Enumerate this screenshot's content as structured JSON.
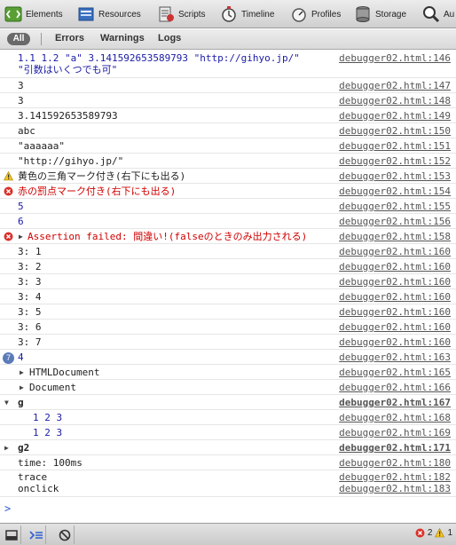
{
  "toolbar": {
    "tabs": [
      {
        "label": "Elements",
        "icon": "elements-icon"
      },
      {
        "label": "Resources",
        "icon": "resources-icon"
      },
      {
        "label": "Scripts",
        "icon": "scripts-icon"
      },
      {
        "label": "Timeline",
        "icon": "timeline-icon"
      },
      {
        "label": "Profiles",
        "icon": "profiles-icon"
      },
      {
        "label": "Storage",
        "icon": "storage-icon"
      },
      {
        "label": "Au",
        "icon": "audits-icon"
      }
    ]
  },
  "filters": {
    "all": "All",
    "errors": "Errors",
    "warnings": "Warnings",
    "logs": "Logs"
  },
  "messages": [
    {
      "text": "1.1 1.2 \"a\" 3.141592653589793 \"http://gihyo.jp/\"\n\"引数はいくつでも可\"",
      "source": "debugger02.html:146",
      "kind": "log",
      "color": "#1a1aa6"
    },
    {
      "text": "3",
      "source": "debugger02.html:147",
      "kind": "log"
    },
    {
      "text": "3",
      "source": "debugger02.html:148",
      "kind": "log"
    },
    {
      "text": "3.141592653589793",
      "source": "debugger02.html:149",
      "kind": "log"
    },
    {
      "text": "abc",
      "source": "debugger02.html:150",
      "kind": "log"
    },
    {
      "text": "\"aaaaaa\"",
      "source": "debugger02.html:151",
      "kind": "log"
    },
    {
      "text": "\"http://gihyo.jp/\"",
      "source": "debugger02.html:152",
      "kind": "log"
    },
    {
      "text": "黄色の三角マーク付き(右下にも出る)",
      "source": "debugger02.html:153",
      "kind": "warning"
    },
    {
      "text": "赤の罰点マーク付き(右下にも出る)",
      "source": "debugger02.html:154",
      "kind": "error",
      "color": "#d00000"
    },
    {
      "text": "5",
      "source": "debugger02.html:155",
      "kind": "log",
      "color": "#1a1aa6"
    },
    {
      "text": "6",
      "source": "debugger02.html:156",
      "kind": "log",
      "color": "#1a1aa6"
    },
    {
      "text": "Assertion failed: 間違い!(falseのときのみ出力される)",
      "source": "debugger02.html:158",
      "kind": "error-expand",
      "color": "#d00000"
    },
    {
      "text": "3: 1",
      "source": "debugger02.html:160",
      "kind": "log"
    },
    {
      "text": "3: 2",
      "source": "debugger02.html:160",
      "kind": "log"
    },
    {
      "text": "3: 3",
      "source": "debugger02.html:160",
      "kind": "log"
    },
    {
      "text": "3: 4",
      "source": "debugger02.html:160",
      "kind": "log"
    },
    {
      "text": "3: 5",
      "source": "debugger02.html:160",
      "kind": "log"
    },
    {
      "text": "3: 6",
      "source": "debugger02.html:160",
      "kind": "log"
    },
    {
      "text": "3: 7",
      "source": "debugger02.html:160",
      "kind": "log"
    },
    {
      "text": "4",
      "source": "debugger02.html:163",
      "kind": "repeat",
      "count": "7",
      "color": "#1a1aa6"
    },
    {
      "text": "HTMLDocument",
      "source": "debugger02.html:165",
      "kind": "expand"
    },
    {
      "text": "Document",
      "source": "debugger02.html:166",
      "kind": "expand"
    },
    {
      "text": "g",
      "source": "debugger02.html:167",
      "kind": "group-open",
      "bold": true
    },
    {
      "text": "1 2 3",
      "source": "debugger02.html:168",
      "kind": "nested",
      "color": "#1a1aa6"
    },
    {
      "text": "1 2 3",
      "source": "debugger02.html:169",
      "kind": "nested",
      "color": "#1a1aa6"
    },
    {
      "text": "g2",
      "source": "debugger02.html:171",
      "kind": "group-closed",
      "bold": true
    },
    {
      "text": "time: 100ms",
      "source": "debugger02.html:180",
      "kind": "log"
    },
    {
      "text": "trace\nonclick",
      "source": "debugger02.html:182\ndebugger02.html:183",
      "kind": "log"
    }
  ],
  "console_prompt": ">",
  "status": {
    "errors": "2",
    "warnings": "1"
  }
}
